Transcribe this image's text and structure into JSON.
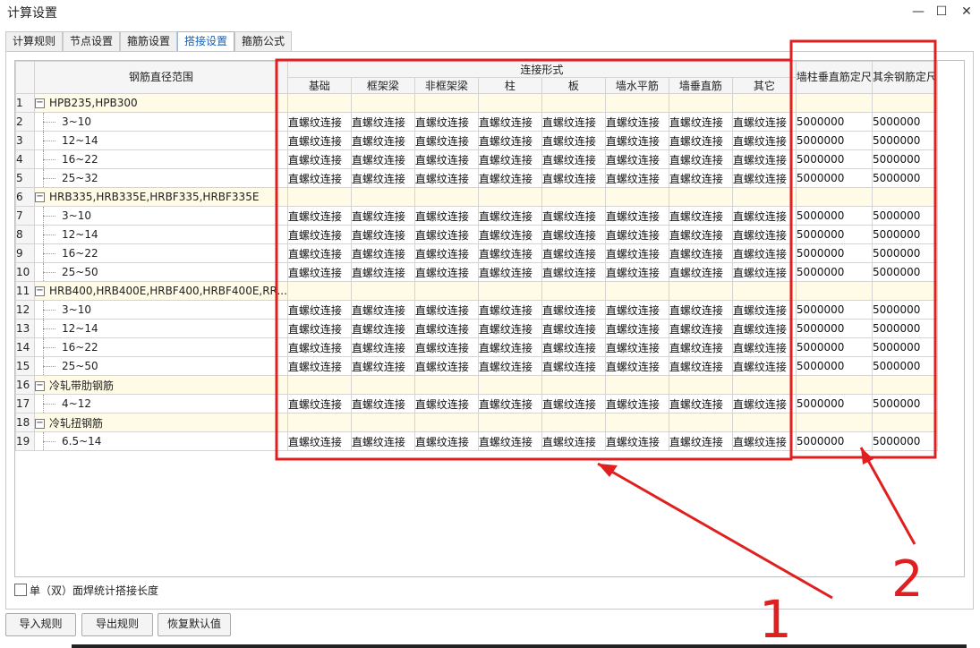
{
  "window": {
    "title": "计算设置",
    "minimize": "—",
    "maximize": "☐",
    "close": "✕"
  },
  "tabs": [
    {
      "label": "计算规则"
    },
    {
      "label": "节点设置"
    },
    {
      "label": "箍筋设置"
    },
    {
      "label": "搭接设置",
      "active": true
    },
    {
      "label": "箍筋公式"
    }
  ],
  "table": {
    "range_header": "钢筋直径范围",
    "group_header": "连接形式",
    "columns": [
      "基础",
      "框架梁",
      "非框架梁",
      "柱",
      "板",
      "墙水平筋",
      "墙垂直筋",
      "其它"
    ],
    "wall_fix": "墙柱垂直筋定尺",
    "other_fix": "其余钢筋定尺",
    "rows": [
      {
        "n": "1",
        "label": "HPB235,HPB300",
        "group": true
      },
      {
        "n": "2",
        "label": "3~10",
        "conn": "直螺纹连接",
        "fix1": "5000000",
        "fix2": "5000000"
      },
      {
        "n": "3",
        "label": "12~14",
        "conn": "直螺纹连接",
        "fix1": "5000000",
        "fix2": "5000000"
      },
      {
        "n": "4",
        "label": "16~22",
        "conn": "直螺纹连接",
        "fix1": "5000000",
        "fix2": "5000000"
      },
      {
        "n": "5",
        "label": "25~32",
        "conn": "直螺纹连接",
        "fix1": "5000000",
        "fix2": "5000000"
      },
      {
        "n": "6",
        "label": "HRB335,HRB335E,HRBF335,HRBF335E",
        "group": true
      },
      {
        "n": "7",
        "label": "3~10",
        "conn": "直螺纹连接",
        "fix1": "5000000",
        "fix2": "5000000"
      },
      {
        "n": "8",
        "label": "12~14",
        "conn": "直螺纹连接",
        "fix1": "5000000",
        "fix2": "5000000"
      },
      {
        "n": "9",
        "label": "16~22",
        "conn": "直螺纹连接",
        "fix1": "5000000",
        "fix2": "5000000"
      },
      {
        "n": "10",
        "label": "25~50",
        "conn": "直螺纹连接",
        "fix1": "5000000",
        "fix2": "5000000"
      },
      {
        "n": "11",
        "label": "HRB400,HRB400E,HRBF400,HRBF400E,RR...",
        "group": true
      },
      {
        "n": "12",
        "label": "3~10",
        "conn": "直螺纹连接",
        "fix1": "5000000",
        "fix2": "5000000"
      },
      {
        "n": "13",
        "label": "12~14",
        "conn": "直螺纹连接",
        "fix1": "5000000",
        "fix2": "5000000"
      },
      {
        "n": "14",
        "label": "16~22",
        "conn": "直螺纹连接",
        "fix1": "5000000",
        "fix2": "5000000"
      },
      {
        "n": "15",
        "label": "25~50",
        "conn": "直螺纹连接",
        "fix1": "5000000",
        "fix2": "5000000"
      },
      {
        "n": "16",
        "label": "冷轧带肋钢筋",
        "group": true
      },
      {
        "n": "17",
        "label": "4~12",
        "conn": "直螺纹连接",
        "fix1": "5000000",
        "fix2": "5000000"
      },
      {
        "n": "18",
        "label": "冷轧扭钢筋",
        "group": true
      },
      {
        "n": "19",
        "label": "6.5~14",
        "conn": "直螺纹连接",
        "fix1": "5000000",
        "fix2": "5000000"
      }
    ]
  },
  "options": {
    "weld_checkbox_label": "单（双）面焊统计搭接长度",
    "weld_checked": false
  },
  "buttons": {
    "import": "导入规则",
    "export": "导出规则",
    "restore": "恢复默认值"
  },
  "annotations": {
    "color": "#e02020",
    "mark1": "1",
    "mark2": "2"
  }
}
